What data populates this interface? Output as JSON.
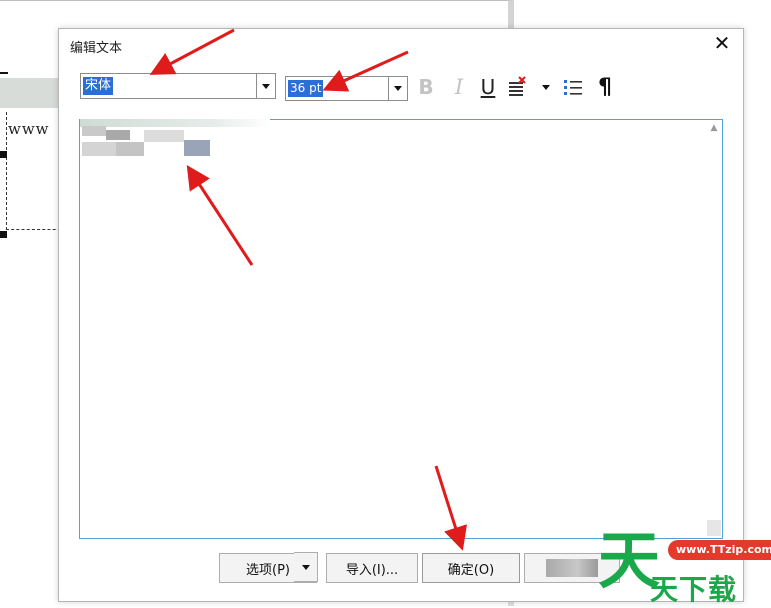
{
  "background": {
    "doc_text": "www"
  },
  "dialog": {
    "title": "编辑文本",
    "close_glyph": "✕",
    "toolbar": {
      "font_name": "宋体",
      "font_size": "36 pt",
      "bold": "B",
      "italic": "I",
      "underline": "U",
      "paragraph": "¶",
      "icons": [
        "chevron-down-icon",
        "bold-icon",
        "italic-icon",
        "underline-icon",
        "strikethrough-icon",
        "bullet-list-icon",
        "paragraph-icon"
      ]
    },
    "buttons": {
      "options": "选项(P)",
      "import": "导入(I)...",
      "ok": "确定(O)"
    }
  },
  "watermark": {
    "url": "www.TTzip.com",
    "big_char": "天",
    "text": "天下载"
  },
  "colors": {
    "selection": "#2b6fd6",
    "editor_border": "#4ea3e0",
    "arrow": "#e01b1b",
    "watermark_green": "#1aa84a",
    "watermark_red": "#e33a2c"
  }
}
